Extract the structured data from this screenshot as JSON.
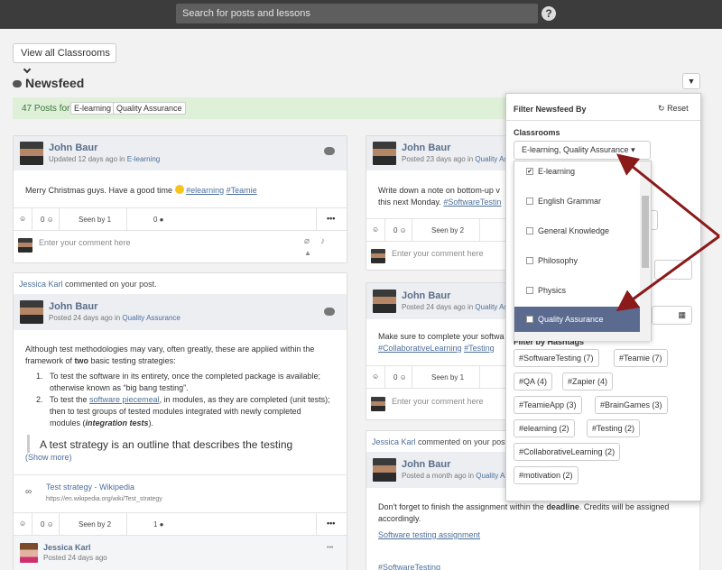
{
  "topbar": {
    "search_placeholder": "Search for posts and lessons",
    "help_label": "?"
  },
  "view_all_label": "View all Classrooms",
  "newsfeed": {
    "title": "Newsfeed",
    "posts_count_label": "47 Posts for:",
    "tags": [
      "E-learning",
      "Quality Assurance"
    ]
  },
  "comment_placeholder": "Enter your comment here",
  "posts": [
    {
      "author": "John Baur",
      "meta_prefix": "Updated 12 days ago in",
      "classroom": "E-learning",
      "body": "Merry Christmas guys. Have a good time",
      "hashtags": [
        "#elearning",
        "#Teamie"
      ],
      "likes": "0",
      "seen": "Seen by 1",
      "comments": "0"
    },
    {
      "commenter": "Jessica Karl",
      "commented_text": "commented on your post.",
      "author": "John Baur",
      "meta_prefix": "Posted 24 days ago in",
      "classroom": "Quality Assurance",
      "intro_a": "Although test methodologies may vary, often greatly, these are applied within the",
      "intro_b": "framework of",
      "intro_bold": "two",
      "intro_c": "basic testing strategies:",
      "item1_a": "To test the software in its entirety, once the completed package is available;",
      "item1_b": "otherwise known as “big bang testing”.",
      "item2_a": "To test the",
      "item2_link": "software piecemeal",
      "item2_b": ", in modules, as they are completed (unit tests);",
      "item2_c": "then to test groups of tested modules integrated with newly completed",
      "item2_d": "modules (",
      "item2_bold": "integration tests",
      "item2_e": ").",
      "quote": "A test strategy is an outline that describes the testing",
      "show_more": "(Show more)",
      "link_title": "Test strategy - Wikipedia",
      "link_url": "https://en.wikipedia.org/wiki/Test_strategy",
      "likes": "0",
      "seen": "Seen by 2",
      "comments": "1",
      "reply_author": "Jessica Karl",
      "reply_meta": "Posted 24 days ago"
    },
    {
      "author": "John Baur",
      "meta_prefix": "Posted 23 days ago in",
      "classroom": "Quality Ass",
      "body_a": "Write down a note on bottom-up v",
      "body_b": "this next Monday.",
      "hashtag": "#SoftwareTestin",
      "likes": "0",
      "seen": "Seen by 2"
    },
    {
      "author": "John Baur",
      "meta_prefix": "Posted 24 days ago in",
      "classroom": "Quality Ass",
      "body_a": "Make sure to complete your softwa",
      "hashtags": [
        "#CollaborativeLearning",
        "#Testing"
      ],
      "likes": "0",
      "seen": "Seen by 1"
    },
    {
      "commenter": "Jessica Karl",
      "commented_text": "commented on your post",
      "author": "John Baur",
      "meta_prefix": "Posted a month ago in",
      "classroom": "Quality Assu",
      "body_a": "Don't forget to finish the assignment within the",
      "body_bold": "deadline",
      "body_b": ". Credits will be assigned",
      "body_c": "accordingly.",
      "link": "Software testing assignment",
      "hashtag": "#SoftwareTesting"
    }
  ],
  "filter": {
    "title": "Filter Newsfeed By",
    "reset_label": "Reset",
    "classrooms_label": "Classrooms",
    "selected_value": "E-learning, Quality Assurance",
    "options": [
      {
        "label": "E-learning",
        "checked": true
      },
      {
        "label": "English Grammar",
        "checked": false
      },
      {
        "label": "General Knowledge",
        "checked": false
      },
      {
        "label": "Philosophy",
        "checked": false
      },
      {
        "label": "Physics",
        "checked": false
      },
      {
        "label": "Quality Assurance",
        "checked": true
      }
    ],
    "hashtag_label": "Filter by Hashtags",
    "hashtags": [
      "#SoftwareTesting (7)",
      "#Teamie (7)",
      "#QA (4)",
      "#Zapier (4)",
      "#TeamieApp (3)",
      "#BrainGames (3)",
      "#elearning (2)",
      "#Testing (2)",
      "#CollaborativeLearning (2)",
      "#motivation (2)"
    ]
  },
  "colors": {
    "topbar": "#3c3c3c",
    "accent_link": "#4d6f9b",
    "selected_option": "#5b6b8f",
    "arrow": "#8b1a1a",
    "green_bar": "#dff0d8"
  }
}
